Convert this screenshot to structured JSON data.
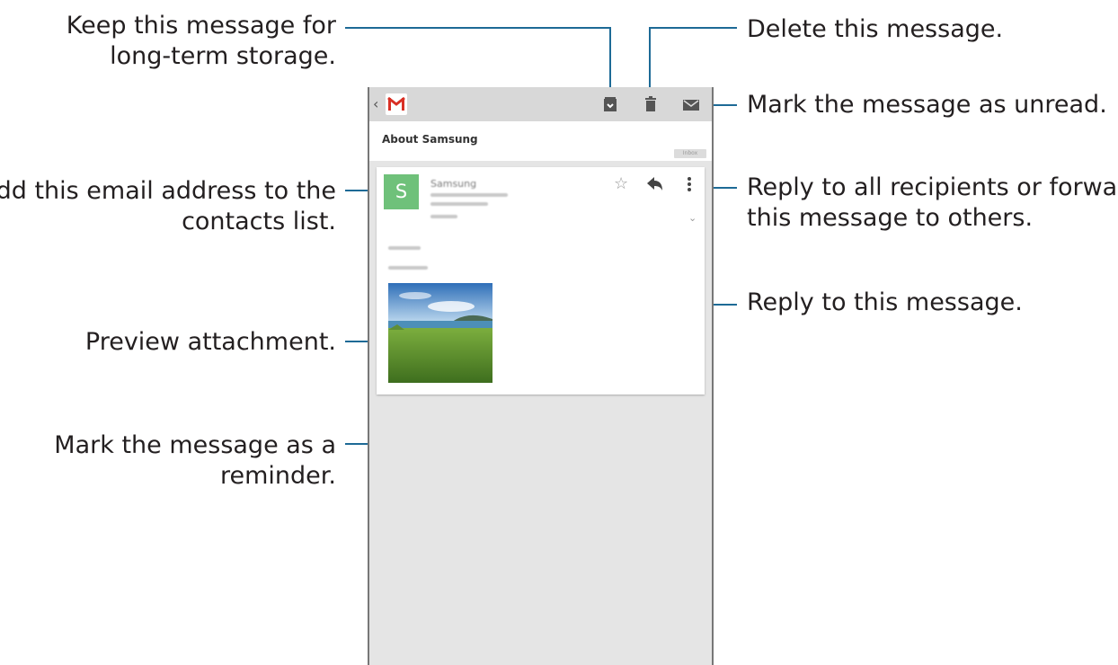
{
  "callouts": {
    "keep": [
      "Keep this message for",
      "long-term storage."
    ],
    "delete": "Delete this message.",
    "unread": "Mark the message as unread.",
    "add_contact": [
      "Add this email address to the",
      "contacts list."
    ],
    "reply_all": [
      "Reply to all recipients or forward",
      "this message to others."
    ],
    "reply": "Reply to this message.",
    "preview": "Preview attachment.",
    "reminder": [
      "Mark the message as a",
      "reminder."
    ]
  },
  "email": {
    "subject": "About Samsung",
    "label": "Inbox",
    "avatar_letter": "S",
    "sender": "Samsung"
  },
  "colors": {
    "callout_line": "#1d6a96",
    "avatar": "#6fc17a",
    "actionbar": "#d8d8d8"
  },
  "icons": [
    "back-arrow-icon",
    "gmail-logo",
    "archive-icon",
    "trash-icon",
    "envelope-icon",
    "star-icon",
    "reply-icon",
    "overflow-menu-icon",
    "chevron-down-icon"
  ]
}
